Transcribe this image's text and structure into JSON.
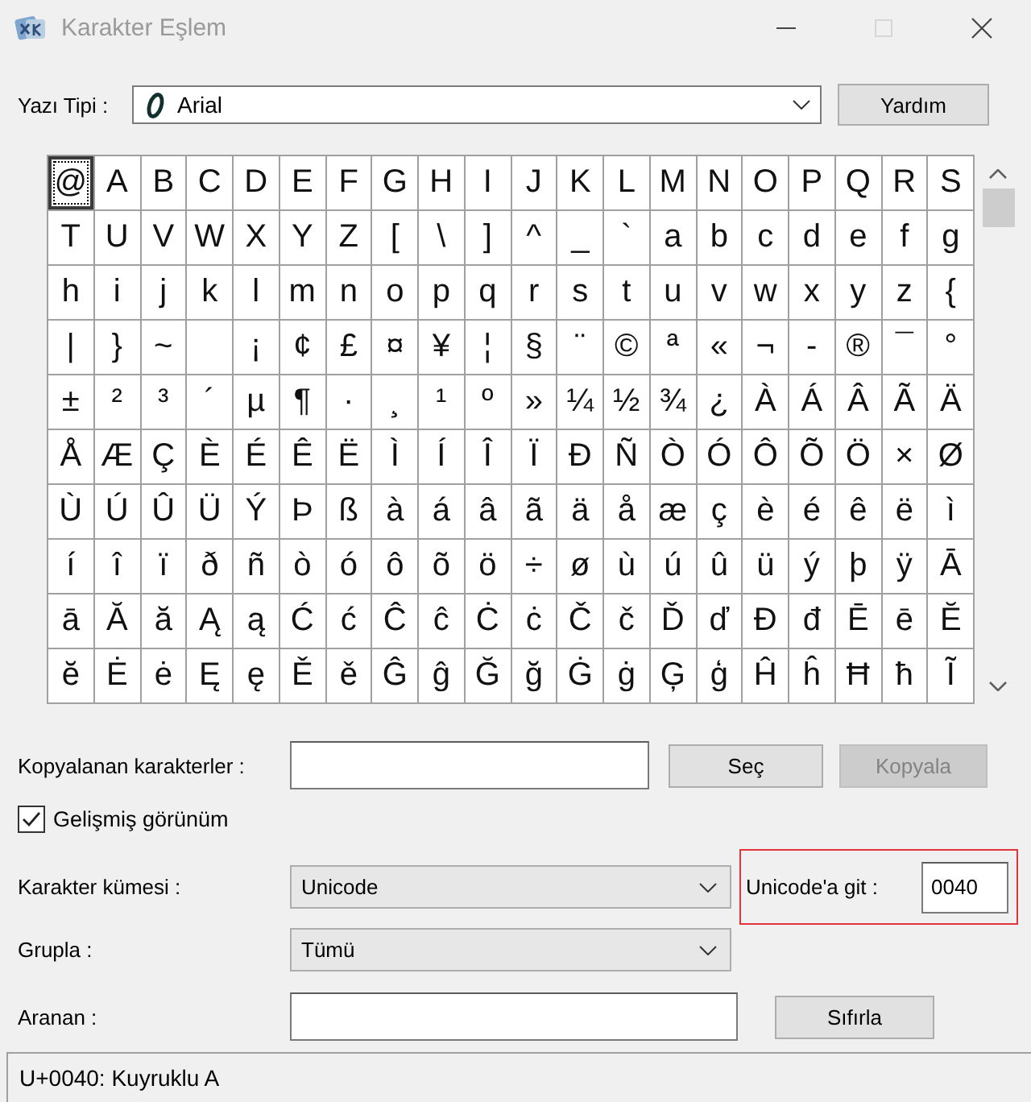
{
  "window": {
    "title": "Karakter Eşlem",
    "active": false,
    "caption_buttons": [
      {
        "kind": "minimize",
        "disabled": false
      },
      {
        "kind": "maximize",
        "disabled": true
      },
      {
        "kind": "close",
        "disabled": false
      }
    ]
  },
  "font": {
    "label": "Yazı Tipi :",
    "value": "Arial"
  },
  "help_button": "Yardım",
  "grid": {
    "rows": [
      [
        {
          "char": "@",
          "selected": true
        },
        {
          "char": "A",
          "selected": false
        },
        {
          "char": "B",
          "selected": false
        },
        {
          "char": "C",
          "selected": false
        },
        {
          "char": "D",
          "selected": false
        },
        {
          "char": "E",
          "selected": false
        },
        {
          "char": "F",
          "selected": false
        },
        {
          "char": "G",
          "selected": false
        },
        {
          "char": "H",
          "selected": false
        },
        {
          "char": "I",
          "selected": false
        },
        {
          "char": "J",
          "selected": false
        },
        {
          "char": "K",
          "selected": false
        },
        {
          "char": "L",
          "selected": false
        },
        {
          "char": "M",
          "selected": false
        },
        {
          "char": "N",
          "selected": false
        },
        {
          "char": "O",
          "selected": false
        },
        {
          "char": "P",
          "selected": false
        },
        {
          "char": "Q",
          "selected": false
        },
        {
          "char": "R",
          "selected": false
        },
        {
          "char": "S",
          "selected": false
        }
      ],
      [
        {
          "char": "T",
          "selected": false
        },
        {
          "char": "U",
          "selected": false
        },
        {
          "char": "V",
          "selected": false
        },
        {
          "char": "W",
          "selected": false
        },
        {
          "char": "X",
          "selected": false
        },
        {
          "char": "Y",
          "selected": false
        },
        {
          "char": "Z",
          "selected": false
        },
        {
          "char": "[",
          "selected": false
        },
        {
          "char": "\\",
          "selected": false
        },
        {
          "char": "]",
          "selected": false
        },
        {
          "char": "^",
          "selected": false
        },
        {
          "char": "_",
          "selected": false
        },
        {
          "char": "`",
          "selected": false
        },
        {
          "char": "a",
          "selected": false
        },
        {
          "char": "b",
          "selected": false
        },
        {
          "char": "c",
          "selected": false
        },
        {
          "char": "d",
          "selected": false
        },
        {
          "char": "e",
          "selected": false
        },
        {
          "char": "f",
          "selected": false
        },
        {
          "char": "g",
          "selected": false
        }
      ],
      [
        {
          "char": "h",
          "selected": false
        },
        {
          "char": "i",
          "selected": false
        },
        {
          "char": "j",
          "selected": false
        },
        {
          "char": "k",
          "selected": false
        },
        {
          "char": "l",
          "selected": false
        },
        {
          "char": "m",
          "selected": false
        },
        {
          "char": "n",
          "selected": false
        },
        {
          "char": "o",
          "selected": false
        },
        {
          "char": "p",
          "selected": false
        },
        {
          "char": "q",
          "selected": false
        },
        {
          "char": "r",
          "selected": false
        },
        {
          "char": "s",
          "selected": false
        },
        {
          "char": "t",
          "selected": false
        },
        {
          "char": "u",
          "selected": false
        },
        {
          "char": "v",
          "selected": false
        },
        {
          "char": "w",
          "selected": false
        },
        {
          "char": "x",
          "selected": false
        },
        {
          "char": "y",
          "selected": false
        },
        {
          "char": "z",
          "selected": false
        },
        {
          "char": "{",
          "selected": false
        }
      ],
      [
        {
          "char": "|",
          "selected": false
        },
        {
          "char": "}",
          "selected": false
        },
        {
          "char": "~",
          "selected": false
        },
        {
          "selected": false
        },
        {
          "char": "¡",
          "selected": false
        },
        {
          "char": "¢",
          "selected": false
        },
        {
          "char": "£",
          "selected": false
        },
        {
          "char": "¤",
          "selected": false
        },
        {
          "char": "¥",
          "selected": false
        },
        {
          "char": "¦",
          "selected": false
        },
        {
          "char": "§",
          "selected": false
        },
        {
          "char": "¨",
          "selected": false
        },
        {
          "char": "©",
          "selected": false
        },
        {
          "char": "ª",
          "selected": false
        },
        {
          "char": "«",
          "selected": false
        },
        {
          "char": "¬",
          "selected": false
        },
        {
          "char": "-",
          "selected": false
        },
        {
          "char": "®",
          "selected": false
        },
        {
          "char": "¯",
          "selected": false
        },
        {
          "char": "°",
          "selected": false
        }
      ],
      [
        {
          "char": "±",
          "selected": false
        },
        {
          "char": "²",
          "selected": false
        },
        {
          "char": "³",
          "selected": false
        },
        {
          "char": "´",
          "selected": false
        },
        {
          "char": "µ",
          "selected": false
        },
        {
          "char": "¶",
          "selected": false
        },
        {
          "char": "·",
          "selected": false
        },
        {
          "char": "¸",
          "selected": false
        },
        {
          "char": "¹",
          "selected": false
        },
        {
          "char": "º",
          "selected": false
        },
        {
          "char": "»",
          "selected": false
        },
        {
          "char": "¼",
          "selected": false
        },
        {
          "char": "½",
          "selected": false
        },
        {
          "char": "¾",
          "selected": false
        },
        {
          "char": "¿",
          "selected": false
        },
        {
          "char": "À",
          "selected": false
        },
        {
          "char": "Á",
          "selected": false
        },
        {
          "char": "Â",
          "selected": false
        },
        {
          "char": "Ã",
          "selected": false
        },
        {
          "char": "Ä",
          "selected": false
        }
      ],
      [
        {
          "char": "Å",
          "selected": false
        },
        {
          "char": "Æ",
          "selected": false
        },
        {
          "char": "Ç",
          "selected": false
        },
        {
          "char": "È",
          "selected": false
        },
        {
          "char": "É",
          "selected": false
        },
        {
          "char": "Ê",
          "selected": false
        },
        {
          "char": "Ë",
          "selected": false
        },
        {
          "char": "Ì",
          "selected": false
        },
        {
          "char": "Í",
          "selected": false
        },
        {
          "char": "Î",
          "selected": false
        },
        {
          "char": "Ï",
          "selected": false
        },
        {
          "char": "Ð",
          "selected": false
        },
        {
          "char": "Ñ",
          "selected": false
        },
        {
          "char": "Ò",
          "selected": false
        },
        {
          "char": "Ó",
          "selected": false
        },
        {
          "char": "Ô",
          "selected": false
        },
        {
          "char": "Õ",
          "selected": false
        },
        {
          "char": "Ö",
          "selected": false
        },
        {
          "char": "×",
          "selected": false
        },
        {
          "char": "Ø",
          "selected": false
        }
      ],
      [
        {
          "char": "Ù",
          "selected": false
        },
        {
          "char": "Ú",
          "selected": false
        },
        {
          "char": "Û",
          "selected": false
        },
        {
          "char": "Ü",
          "selected": false
        },
        {
          "char": "Ý",
          "selected": false
        },
        {
          "char": "Þ",
          "selected": false
        },
        {
          "char": "ß",
          "selected": false
        },
        {
          "char": "à",
          "selected": false
        },
        {
          "char": "á",
          "selected": false
        },
        {
          "char": "â",
          "selected": false
        },
        {
          "char": "ã",
          "selected": false
        },
        {
          "char": "ä",
          "selected": false
        },
        {
          "char": "å",
          "selected": false
        },
        {
          "char": "æ",
          "selected": false
        },
        {
          "char": "ç",
          "selected": false
        },
        {
          "char": "è",
          "selected": false
        },
        {
          "char": "é",
          "selected": false
        },
        {
          "char": "ê",
          "selected": false
        },
        {
          "char": "ë",
          "selected": false
        },
        {
          "char": "ì",
          "selected": false
        }
      ],
      [
        {
          "char": "í",
          "selected": false
        },
        {
          "char": "î",
          "selected": false
        },
        {
          "char": "ï",
          "selected": false
        },
        {
          "char": "ð",
          "selected": false
        },
        {
          "char": "ñ",
          "selected": false
        },
        {
          "char": "ò",
          "selected": false
        },
        {
          "char": "ó",
          "selected": false
        },
        {
          "char": "ô",
          "selected": false
        },
        {
          "char": "õ",
          "selected": false
        },
        {
          "char": "ö",
          "selected": false
        },
        {
          "char": "÷",
          "selected": false
        },
        {
          "char": "ø",
          "selected": false
        },
        {
          "char": "ù",
          "selected": false
        },
        {
          "char": "ú",
          "selected": false
        },
        {
          "char": "û",
          "selected": false
        },
        {
          "char": "ü",
          "selected": false
        },
        {
          "char": "ý",
          "selected": false
        },
        {
          "char": "þ",
          "selected": false
        },
        {
          "char": "ÿ",
          "selected": false
        },
        {
          "char": "Ā",
          "selected": false
        }
      ],
      [
        {
          "char": "ā",
          "selected": false
        },
        {
          "char": "Ă",
          "selected": false
        },
        {
          "char": "ă",
          "selected": false
        },
        {
          "char": "Ą",
          "selected": false
        },
        {
          "char": "ą",
          "selected": false
        },
        {
          "char": "Ć",
          "selected": false
        },
        {
          "char": "ć",
          "selected": false
        },
        {
          "char": "Ĉ",
          "selected": false
        },
        {
          "char": "ĉ",
          "selected": false
        },
        {
          "char": "Ċ",
          "selected": false
        },
        {
          "char": "ċ",
          "selected": false
        },
        {
          "char": "Č",
          "selected": false
        },
        {
          "char": "č",
          "selected": false
        },
        {
          "char": "Ď",
          "selected": false
        },
        {
          "char": "ď",
          "selected": false
        },
        {
          "char": "Đ",
          "selected": false
        },
        {
          "char": "đ",
          "selected": false
        },
        {
          "char": "Ē",
          "selected": false
        },
        {
          "char": "ē",
          "selected": false
        },
        {
          "char": "Ĕ",
          "selected": false
        }
      ],
      [
        {
          "char": "ĕ",
          "selected": false
        },
        {
          "char": "Ė",
          "selected": false
        },
        {
          "char": "ė",
          "selected": false
        },
        {
          "char": "Ę",
          "selected": false
        },
        {
          "char": "ę",
          "selected": false
        },
        {
          "char": "Ě",
          "selected": false
        },
        {
          "char": "ě",
          "selected": false
        },
        {
          "char": "Ĝ",
          "selected": false
        },
        {
          "char": "ĝ",
          "selected": false
        },
        {
          "char": "Ğ",
          "selected": false
        },
        {
          "char": "ğ",
          "selected": false
        },
        {
          "char": "Ġ",
          "selected": false
        },
        {
          "char": "ġ",
          "selected": false
        },
        {
          "char": "Ģ",
          "selected": false
        },
        {
          "char": "ģ",
          "selected": false
        },
        {
          "char": "Ĥ",
          "selected": false
        },
        {
          "char": "ĥ",
          "selected": false
        },
        {
          "char": "Ħ",
          "selected": false
        },
        {
          "char": "ħ",
          "selected": false
        },
        {
          "char": "Ĩ",
          "selected": false
        }
      ]
    ]
  },
  "copy": {
    "label": "Kopyalanan karakterler :",
    "buttons": [
      {
        "label": "Seç",
        "disabled": false
      },
      {
        "label": "Kopyala",
        "disabled": true
      }
    ]
  },
  "advanced_view": {
    "label": "Gelişmiş görünüm",
    "checked": true
  },
  "character_set": {
    "label": "Karakter kümesi :",
    "value": "Unicode"
  },
  "go_to_unicode": {
    "label": "Unicode'a git :",
    "value": "0040",
    "highlighted": true
  },
  "group_by": {
    "label": "Grupla :",
    "value": "Tümü"
  },
  "search": {
    "label": "Aranan :",
    "button": "Sıfırla"
  },
  "status_bar": {
    "text": "U+0040: Kuyruklu A"
  }
}
